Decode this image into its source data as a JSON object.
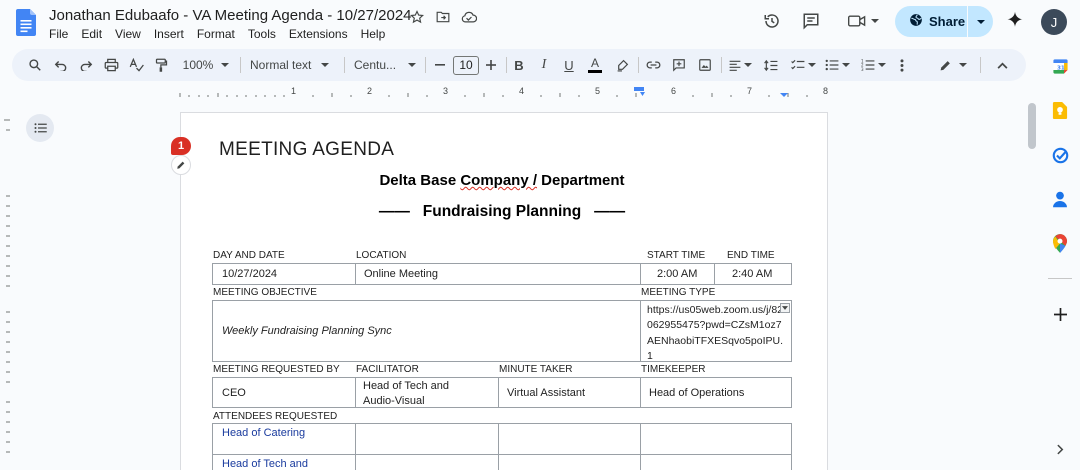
{
  "document": {
    "title": "Jonathan Edubaafo - VA Meeting Agenda - 10/27/2024"
  },
  "menu": [
    "File",
    "Edit",
    "View",
    "Insert",
    "Format",
    "Tools",
    "Extensions",
    "Help"
  ],
  "share": {
    "label": "Share"
  },
  "user": {
    "initial": "J"
  },
  "toolbar": {
    "zoom": "100%",
    "style": "Normal text",
    "font": "Centu...",
    "font_size": "10"
  },
  "ruler": {
    "numbers": [
      "1",
      "2",
      "3",
      "4",
      "5",
      "6",
      "7",
      "8"
    ]
  },
  "comments": {
    "count": "1"
  },
  "agenda": {
    "heading": "MEETING AGENDA",
    "company_part1": "Delta Base ",
    "company_part2": "Company /",
    "company_part3": " Department",
    "topic": "Fundraising Planning",
    "topic_dash": "——",
    "labels": {
      "day_and_date": "DAY AND DATE",
      "location": "LOCATION",
      "start_time": "START TIME",
      "end_time": "END TIME",
      "meeting_objective": "MEETING OBJECTIVE",
      "meeting_type": "MEETING TYPE",
      "requested_by": "MEETING REQUESTED BY",
      "facilitator": "FACILITATOR",
      "minute_taker": "MINUTE TAKER",
      "timekeeper": "TIMEKEEPER",
      "attendees_requested": "ATTENDEES REQUESTED"
    },
    "values": {
      "date": "10/27/2024",
      "location": "Online Meeting",
      "start_time": "2:00 AM",
      "end_time": "2:40 AM",
      "objective": "Weekly Fundraising Planning Sync",
      "meeting_type_url": "https://us05web.zoom.us/j/82062955475?pwd=CZsM1oz7AENhaobiTFXESqvo5poIPU.1",
      "requested_by": "CEO",
      "facilitator_line1": "Head of Tech and",
      "facilitator_line2": "Audio-Visual",
      "minute_taker": "Virtual Assistant",
      "timekeeper": "Head of Operations"
    },
    "attendees": [
      "Head of Catering",
      "Head of Tech and"
    ]
  },
  "colors": {
    "share_bg": "#c2e7ff",
    "toolbar_bg": "#edf2fa",
    "comment_badge": "#d93025",
    "attendee_text": "#1a3b9e"
  }
}
